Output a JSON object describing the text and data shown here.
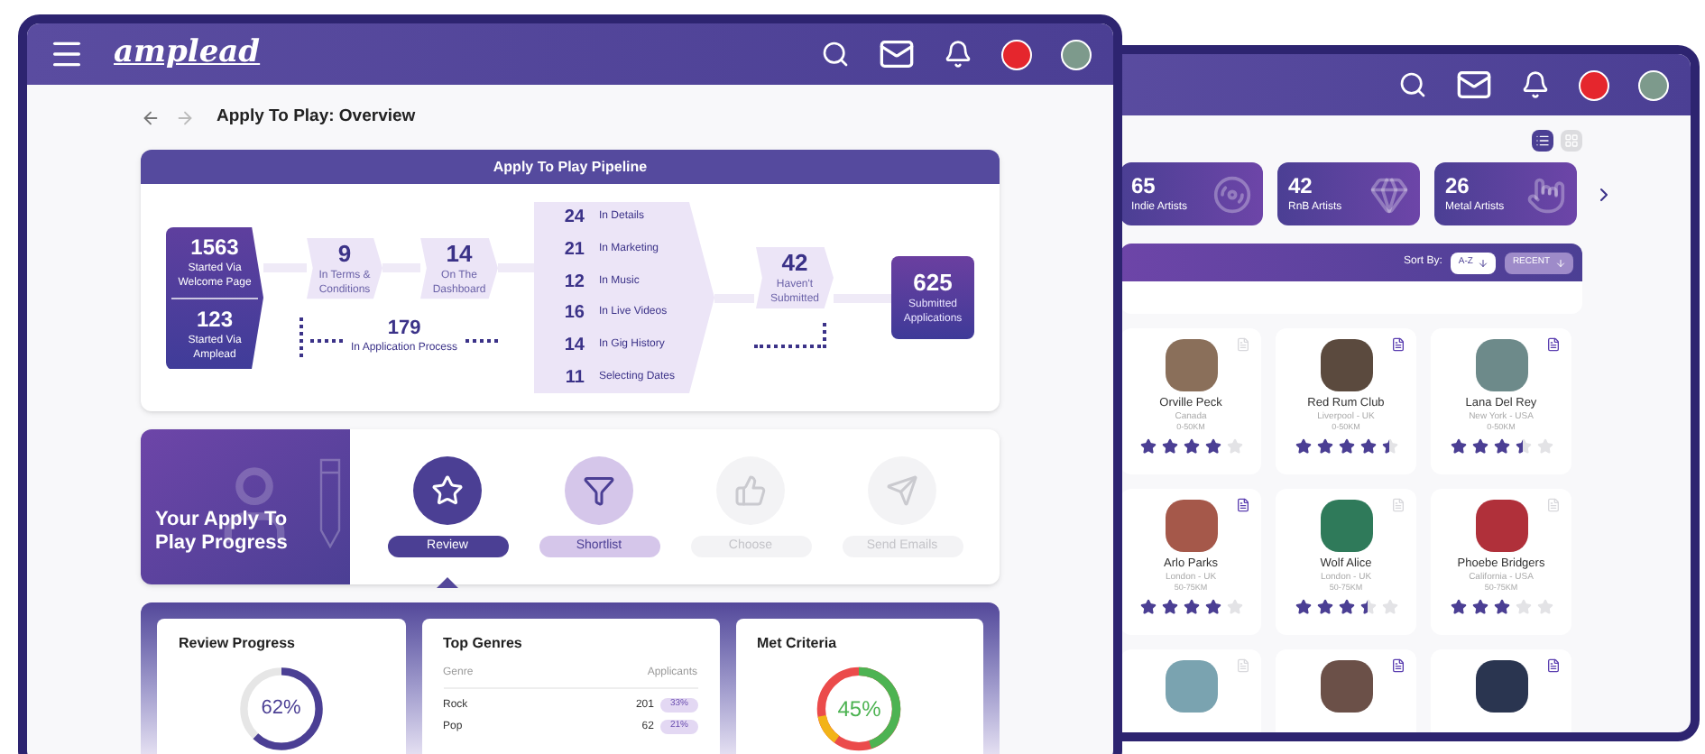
{
  "front_window": {
    "logo": "amplead",
    "page_title": "Apply To Play: Overview",
    "pipeline": {
      "title": "Apply To Play Pipeline",
      "start": [
        {
          "count": "1563",
          "label": "Started Via Welcome Page"
        },
        {
          "count": "123",
          "label": "Started Via Amplead"
        }
      ],
      "steps": [
        {
          "count": "9",
          "label": "In Terms & Conditions"
        },
        {
          "count": "14",
          "label": "On The Dashboard"
        }
      ],
      "in_process": {
        "count": "179",
        "label": "In Application Process"
      },
      "sections": [
        {
          "count": "24",
          "label": "In Details"
        },
        {
          "count": "21",
          "label": "In Marketing"
        },
        {
          "count": "12",
          "label": "In Music"
        },
        {
          "count": "16",
          "label": "In Live Videos"
        },
        {
          "count": "14",
          "label": "In Gig History"
        },
        {
          "count": "11",
          "label": "Selecting Dates"
        }
      ],
      "not_submitted": {
        "count": "42",
        "label": "Haven't Submitted"
      },
      "submitted": {
        "count": "625",
        "label": "Submitted Applications"
      }
    },
    "progress": {
      "title": "Your Apply To Play Progress",
      "stages": [
        {
          "kind": "star",
          "label": "Review",
          "selected": true,
          "disabled": false
        },
        {
          "kind": "filter",
          "label": "Shortlist",
          "selected": false,
          "disabled": false
        },
        {
          "kind": "thumb",
          "label": "Choose",
          "selected": false,
          "disabled": true
        },
        {
          "kind": "send",
          "label": "Send Emails",
          "selected": false,
          "disabled": true
        }
      ]
    },
    "review_progress": {
      "title": "Review Progress",
      "level": 0.62,
      "reading": "62%"
    },
    "top_genres": {
      "title": "Top Genres",
      "columns": [
        "Genre",
        "Applicants"
      ],
      "rows": [
        {
          "genre": "Rock",
          "applicants": "201",
          "share": "33%"
        },
        {
          "genre": "Pop",
          "applicants": "62",
          "share": "21%"
        }
      ]
    },
    "met_criteria": {
      "title": "Met Criteria",
      "level": 0.45,
      "reading": "45%"
    }
  },
  "back_window": {
    "views": [
      {
        "kind": "list",
        "selected": true
      },
      {
        "kind": "grid",
        "selected": false
      }
    ],
    "categories": [
      {
        "kind": "disc",
        "count": "65",
        "label": "Indie Artists"
      },
      {
        "kind": "gem",
        "count": "42",
        "label": "RnB Artists"
      },
      {
        "kind": "hand",
        "count": "26",
        "label": "Metal Artists"
      }
    ],
    "sort_label": "Sort By:",
    "sort_options": [
      {
        "label": "A-Z",
        "selected": true
      },
      {
        "label": "RECENT",
        "selected": false
      }
    ],
    "artists": [
      {
        "name": "Orville Peck",
        "location": "Canada",
        "distance": "0-50KM",
        "stars": 4,
        "document_marked": false
      },
      {
        "name": "Red Rum Club",
        "location": "Liverpool - UK",
        "distance": "0-50KM",
        "stars": 4.5,
        "document_marked": true
      },
      {
        "name": "Lana Del Rey",
        "location": "New York - USA",
        "distance": "0-50KM",
        "stars": 3.5,
        "document_marked": true
      },
      {
        "name": "Arlo Parks",
        "location": "London - UK",
        "distance": "50-75KM",
        "stars": 4,
        "document_marked": true
      },
      {
        "name": "Wolf Alice",
        "location": "London - UK",
        "distance": "50-75KM",
        "stars": 3.5,
        "document_marked": false
      },
      {
        "name": "Phoebe Bridgers",
        "location": "California - USA",
        "distance": "50-75KM",
        "stars": 3,
        "document_marked": false
      },
      {
        "document_marked": false
      },
      {
        "document_marked": true
      },
      {
        "document_marked": true
      }
    ]
  }
}
